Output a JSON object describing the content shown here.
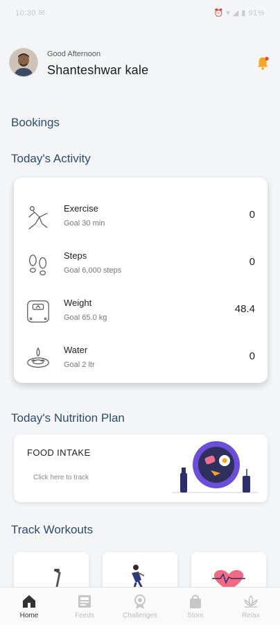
{
  "status_bar": {
    "left": "10:30 ✉",
    "right": "⏰ ▾ ◢ ▮ 91%"
  },
  "header": {
    "greeting": "Good Afternoon",
    "user_name": "Shanteshwar kale",
    "bell_color": "#f5a623"
  },
  "sections": {
    "bookings": "Bookings",
    "activity": "Today's Activity",
    "nutrition": "Today's Nutrition Plan",
    "workouts": "Track Workouts"
  },
  "activities": [
    {
      "name": "Exercise",
      "goal": "Goal 30 min",
      "value": "0",
      "icon": "exercise-icon"
    },
    {
      "name": "Steps",
      "goal": "Goal 6,000 steps",
      "value": "0",
      "icon": "footsteps-icon"
    },
    {
      "name": "Weight",
      "goal": "Goal 65.0 kg",
      "value": "48.4",
      "icon": "scale-icon"
    },
    {
      "name": "Water",
      "goal": "Goal 2 ltr",
      "value": "0",
      "icon": "water-drop-icon"
    }
  ],
  "nutrition": {
    "title": "FOOD INTAKE",
    "subtitle": "Click here to track"
  },
  "workouts": [
    "treadmill-icon",
    "runner-icon",
    "heart-rate-icon"
  ],
  "nav": [
    {
      "label": "Home",
      "icon": "home-icon",
      "active": true
    },
    {
      "label": "Feeds",
      "icon": "feeds-icon",
      "active": false
    },
    {
      "label": "Challenges",
      "icon": "medal-icon",
      "active": false
    },
    {
      "label": "Store",
      "icon": "shopping-bag-icon",
      "active": false
    },
    {
      "label": "Relax",
      "icon": "lotus-icon",
      "active": false
    }
  ],
  "accent_color": "#2e4a6b"
}
